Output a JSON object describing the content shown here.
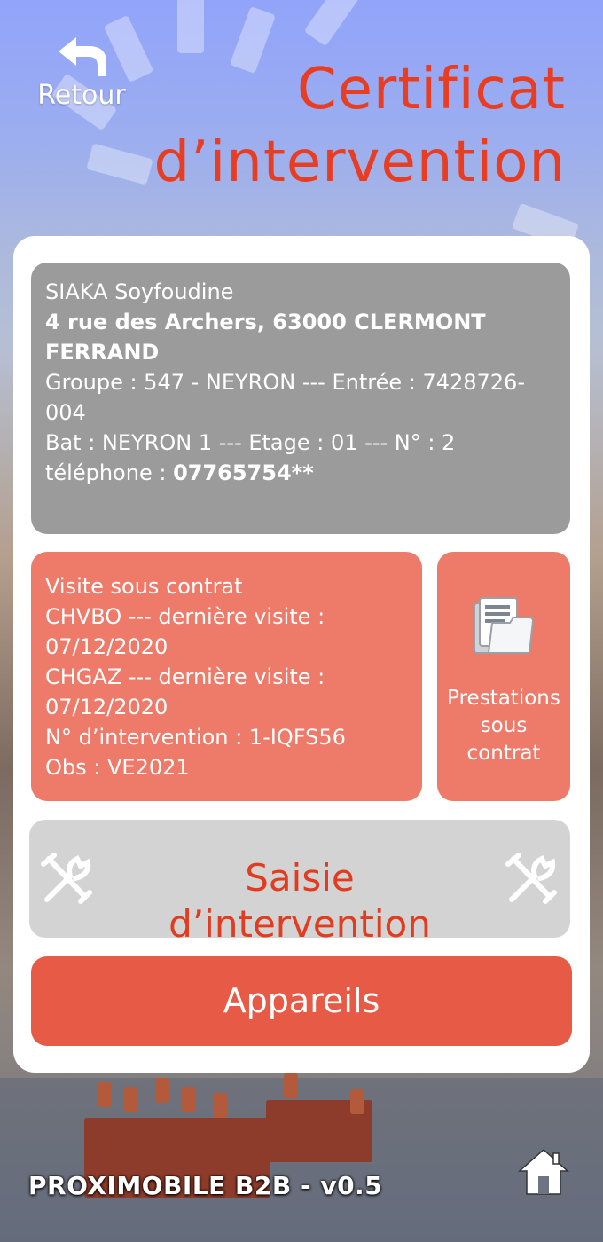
{
  "header": {
    "back_label": "Retour",
    "title_line1": "Certificat",
    "title_line2": "d’intervention"
  },
  "client": {
    "name": "SIAKA Soyfoudine",
    "address": "4 rue des Archers, 63000 CLERMONT FERRAND",
    "groupe_line": "Groupe : 547 - NEYRON    ---    Entrée : 7428726-004",
    "bat_line": "Bat : NEYRON 1    ---     Etage : 01     ---     N° : 2",
    "phone_label": "téléphone : ",
    "phone_value": "07765754**"
  },
  "visit": {
    "title": "Visite sous contrat",
    "line1": "CHVBO   --- dernière visite : 07/12/2020",
    "line2": "CHGAZ   --- dernière visite : 07/12/2020",
    "intervention": "N° d’intervention : 1-IQFS56",
    "obs": "Obs : VE2021"
  },
  "prestations": {
    "label_line1": "Prestations",
    "label_line2": "sous",
    "label_line3": "contrat",
    "icon": "folder-documents-icon"
  },
  "actions": {
    "saisie_label": "Saisie d’intervention",
    "saisie_icon": "tools-icon",
    "appareils_label": "Appareils"
  },
  "footer": {
    "app_version": "PROXIMOBILE B2B - v0.5",
    "home_icon": "home-icon"
  },
  "colors": {
    "accent_red": "#e83d20",
    "visit_salmon": "#ee7a6a",
    "appareils_red": "#e75a45",
    "info_grey": "#9b9b9b",
    "saisie_grey": "#d3d3d3"
  }
}
